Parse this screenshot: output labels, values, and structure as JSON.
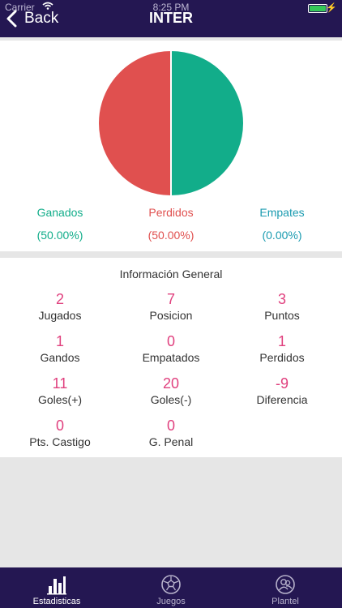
{
  "status": {
    "carrier": "Carrier",
    "time": "8:25 PM"
  },
  "nav": {
    "back_label": "Back",
    "title": "INTER"
  },
  "chart_data": {
    "type": "pie",
    "slices": [
      {
        "name": "Ganados",
        "value": 50.0,
        "color": "#12ad8a"
      },
      {
        "name": "Perdidos",
        "value": 50.0,
        "color": "#e0504f"
      },
      {
        "name": "Empates",
        "value": 0.0,
        "color": "#1a9bb0"
      }
    ]
  },
  "legend": [
    {
      "label": "Ganados",
      "pct": "(50.00%)",
      "color": "#12ad8a"
    },
    {
      "label": "Perdidos",
      "pct": "(50.00%)",
      "color": "#e0504f"
    },
    {
      "label": "Empates",
      "pct": "(0.00%)",
      "color": "#1a9bb0"
    }
  ],
  "info": {
    "title": "Información General",
    "stats": [
      {
        "value": "2",
        "label": "Jugados"
      },
      {
        "value": "7",
        "label": "Posicion"
      },
      {
        "value": "3",
        "label": "Puntos"
      },
      {
        "value": "1",
        "label": "Gandos"
      },
      {
        "value": "0",
        "label": "Empatados"
      },
      {
        "value": "1",
        "label": "Perdidos"
      },
      {
        "value": "11",
        "label": "Goles(+)"
      },
      {
        "value": "20",
        "label": "Goles(-)"
      },
      {
        "value": "-9",
        "label": "Diferencia"
      },
      {
        "value": "0",
        "label": "Pts. Castigo"
      },
      {
        "value": "0",
        "label": "G. Penal"
      }
    ]
  },
  "tabs": [
    {
      "label": "Estadisticas",
      "icon": "bar-chart-icon",
      "active": true
    },
    {
      "label": "Juegos",
      "icon": "soccer-ball-icon",
      "active": false
    },
    {
      "label": "Plantel",
      "icon": "team-icon",
      "active": false
    }
  ]
}
